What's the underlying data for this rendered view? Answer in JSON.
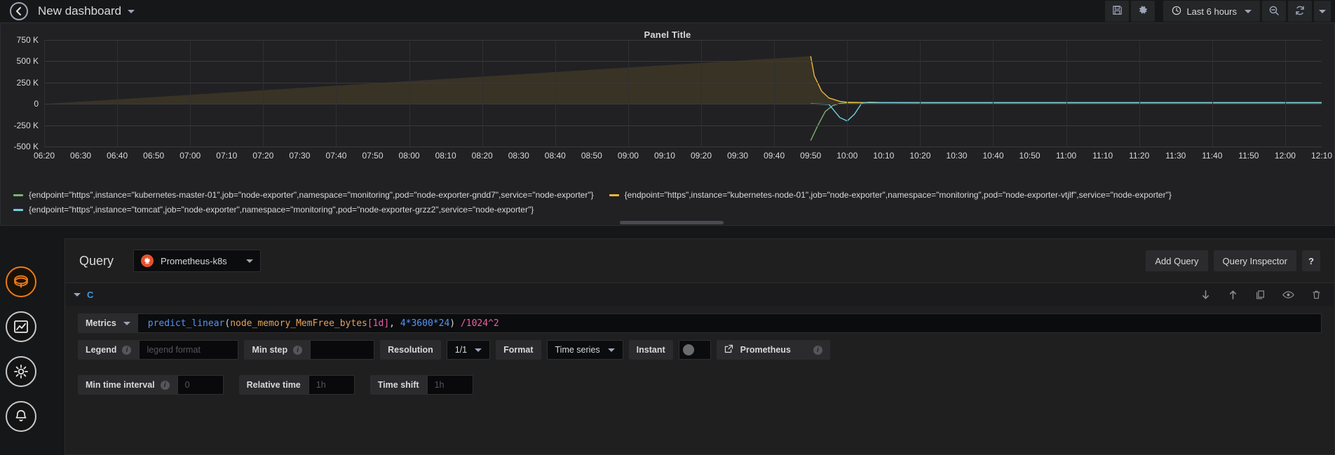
{
  "topnav": {
    "back_icon": "arrow-left-circle-icon",
    "dashboard_title": "New dashboard",
    "dashboard_caret": "chevron-down-icon",
    "save_icon": "save-disk-icon",
    "settings_icon": "gear-icon",
    "time_picker": {
      "clock_icon": "clock-icon",
      "label": "Last 6 hours",
      "caret": "chevron-down-icon"
    },
    "zoom_out_icon": "search-minus-icon",
    "refresh_icon": "refresh-icon",
    "refresh_caret": "chevron-down-icon"
  },
  "panel": {
    "title": "Panel Title",
    "scrollbar": "panel-horizontal-scrollbar"
  },
  "chart_data": {
    "type": "line",
    "title": "Panel Title",
    "xlabel": "",
    "ylabel": "",
    "grid": true,
    "legend_position": "bottom",
    "ylim": [
      -500000,
      750000
    ],
    "ytick_labels": [
      "750 K",
      "500 K",
      "250 K",
      "0",
      "-250 K",
      "-500 K"
    ],
    "ytick_values": [
      750000,
      500000,
      250000,
      0,
      -250000,
      -500000
    ],
    "xtick_labels": [
      "06:20",
      "06:30",
      "06:40",
      "06:50",
      "07:00",
      "07:10",
      "07:20",
      "07:30",
      "07:40",
      "07:50",
      "08:00",
      "08:10",
      "08:20",
      "08:30",
      "08:40",
      "08:50",
      "09:00",
      "09:10",
      "09:20",
      "09:30",
      "09:40",
      "09:50",
      "10:00",
      "10:10",
      "10:20",
      "10:30",
      "10:40",
      "10:50",
      "11:00",
      "11:10",
      "11:20",
      "11:30",
      "11:40",
      "11:50",
      "12:00",
      "12:10"
    ],
    "series": [
      {
        "name": "{endpoint=\"https\",instance=\"kubernetes-master-01\",job=\"node-exporter\",namespace=\"monitoring\",pod=\"node-exporter-gndd7\",service=\"node-exporter\"}",
        "color": "#7eb26d",
        "x": [
          "09:50",
          "09:52",
          "09:54",
          "09:56",
          "09:58",
          "10:00",
          "10:05",
          "10:10",
          "10:20",
          "10:40",
          "11:00",
          "11:30",
          "12:10"
        ],
        "values": [
          -430000,
          -250000,
          -90000,
          -20000,
          5000,
          12000,
          14000,
          14000,
          14000,
          14000,
          14000,
          14000,
          14000
        ]
      },
      {
        "name": "{endpoint=\"https\",instance=\"kubernetes-node-01\",job=\"node-exporter\",namespace=\"monitoring\",pod=\"node-exporter-vtjlf\",service=\"node-exporter\"}",
        "color": "#eab839",
        "x": [
          "09:50",
          "09:51",
          "09:53",
          "09:55",
          "09:58",
          "10:00",
          "10:05",
          "10:10",
          "10:20",
          "10:40",
          "11:00",
          "11:30",
          "12:10"
        ],
        "values": [
          560000,
          330000,
          150000,
          70000,
          30000,
          20000,
          16000,
          15000,
          14000,
          14000,
          14000,
          14000,
          14000
        ]
      },
      {
        "name": "{endpoint=\"https\",instance=\"tomcat\",job=\"node-exporter\",namespace=\"monitoring\",pod=\"node-exporter-grzz2\",service=\"node-exporter\"}",
        "color": "#6ed0e0",
        "x": [
          "09:50",
          "09:55",
          "09:58",
          "10:00",
          "10:02",
          "10:04",
          "10:06",
          "10:10",
          "10:20",
          "10:40",
          "11:00",
          "11:30",
          "12:10"
        ],
        "values": [
          0,
          -5000,
          -160000,
          -200000,
          -120000,
          10000,
          20000,
          16000,
          14000,
          14000,
          14000,
          14000,
          14000
        ]
      }
    ]
  },
  "editor": {
    "query_label": "Query",
    "datasource": {
      "icon": "prometheus-icon",
      "name": "Prometheus-k8s",
      "caret": "chevron-down-icon"
    },
    "add_query_label": "Add Query",
    "query_inspector_label": "Query Inspector",
    "help_label": "?",
    "row": {
      "ref_id": "C",
      "collapse_caret": "chevron-down-icon",
      "actions": [
        {
          "name": "move-down-icon",
          "glyph": "arrow-down"
        },
        {
          "name": "move-up-icon",
          "glyph": "arrow-up"
        },
        {
          "name": "duplicate-query-icon",
          "glyph": "copy"
        },
        {
          "name": "toggle-visibility-icon",
          "glyph": "eye"
        },
        {
          "name": "delete-query-icon",
          "glyph": "trash"
        }
      ],
      "metrics_label": "Metrics",
      "metrics_caret": "chevron-down-icon",
      "expression": {
        "full": "predict_linear(node_memory_MemFree_bytes[1d], 4*3600*24) /1024^2",
        "tokens": [
          {
            "t": "predict_linear",
            "k": "fn"
          },
          {
            "t": "(",
            "k": "punc"
          },
          {
            "t": "node_memory_MemFree_bytes",
            "k": "metric"
          },
          {
            "t": "[1d]",
            "k": "range"
          },
          {
            "t": ", ",
            "k": "punc"
          },
          {
            "t": "4*3600*24",
            "k": "num"
          },
          {
            "t": ")",
            "k": "punc"
          },
          {
            "t": " /1024^2",
            "k": "op"
          }
        ]
      },
      "legend_label": "Legend",
      "legend_info_icon": "info-icon",
      "legend_placeholder": "legend format",
      "legend_value": "",
      "min_step_label": "Min step",
      "min_step_info_icon": "info-icon",
      "min_step_value": "",
      "resolution_label": "Resolution",
      "resolution_value": "1/1",
      "resolution_caret": "chevron-down-icon",
      "format_label": "Format",
      "format_value": "Time series",
      "format_caret": "chevron-down-icon",
      "instant_label": "Instant",
      "instant_toggle": "off",
      "prometheus_link_label": "Prometheus",
      "prometheus_link_icon": "external-link-icon",
      "prometheus_info_icon": "info-icon",
      "min_time_interval_label": "Min time interval",
      "min_time_interval_info_icon": "info-icon",
      "min_time_interval_placeholder": "0",
      "min_time_interval_value": "",
      "relative_time_label": "Relative time",
      "relative_time_placeholder": "1h",
      "relative_time_value": "",
      "time_shift_label": "Time shift",
      "time_shift_placeholder": "1h",
      "time_shift_value": ""
    }
  },
  "side_menu": {
    "items": [
      {
        "name": "grafana-logo-orb",
        "icon": "grafana-logo-icon",
        "active": true
      },
      {
        "name": "visualization-orb",
        "icon": "graph-icon",
        "active": false
      },
      {
        "name": "queries-settings-orb",
        "icon": "gear-cog-icon",
        "active": false
      },
      {
        "name": "alert-orb",
        "icon": "bell-icon",
        "active": false
      }
    ]
  },
  "colors": {
    "accent": "#eb7b18",
    "series_green": "#7eb26d",
    "series_yellow": "#eab839",
    "series_cyan": "#6ed0e0",
    "ref_blue": "#3b9ae0",
    "prometheus_orange": "#e6522c"
  }
}
